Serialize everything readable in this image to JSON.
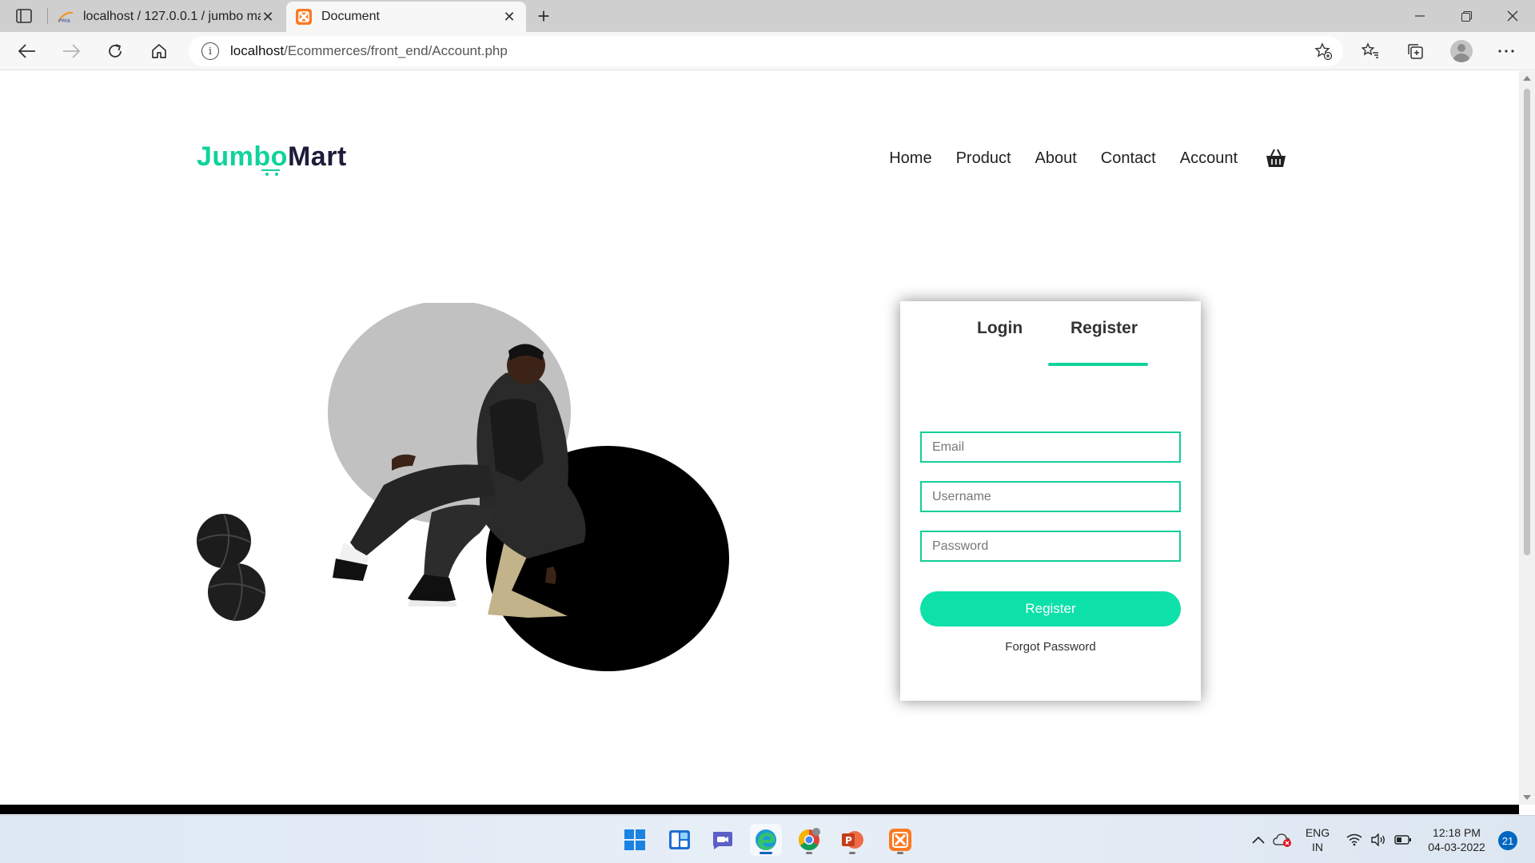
{
  "browser": {
    "tabs": [
      {
        "title": "localhost / 127.0.0.1 / jumbo ma",
        "icon": "phpmyadmin-icon",
        "active": false
      },
      {
        "title": "Document",
        "icon": "xampp-icon",
        "active": true
      }
    ],
    "address": {
      "host": "localhost",
      "path": "/Ecommerces/front_end/Account.php"
    }
  },
  "site": {
    "logo": {
      "prefix": "Jumbo",
      "letter": "M",
      "suffix": "art"
    },
    "nav": [
      "Home",
      "Product",
      "About",
      "Contact",
      "Account"
    ],
    "cart_icon": "basket-icon"
  },
  "auth": {
    "tabs": {
      "login": "Login",
      "register": "Register"
    },
    "active_tab": "Register",
    "fields": {
      "email_placeholder": "Email",
      "username_placeholder": "Username",
      "password_placeholder": "Password"
    },
    "submit_label": "Register",
    "forgot_label": "Forgot Password"
  },
  "taskbar": {
    "apps": [
      "start-icon",
      "widgets-icon",
      "teams-chat-icon",
      "edge-icon",
      "chrome-icon",
      "powerpoint-icon",
      "xampp-icon"
    ],
    "lang_top": "ENG",
    "lang_bottom": "IN",
    "time": "12:18 PM",
    "date": "04-03-2022",
    "notifications": "21"
  },
  "colors": {
    "accent": "#0fd39c",
    "button": "#0de0a8",
    "logo_dark": "#1d1d3a"
  }
}
